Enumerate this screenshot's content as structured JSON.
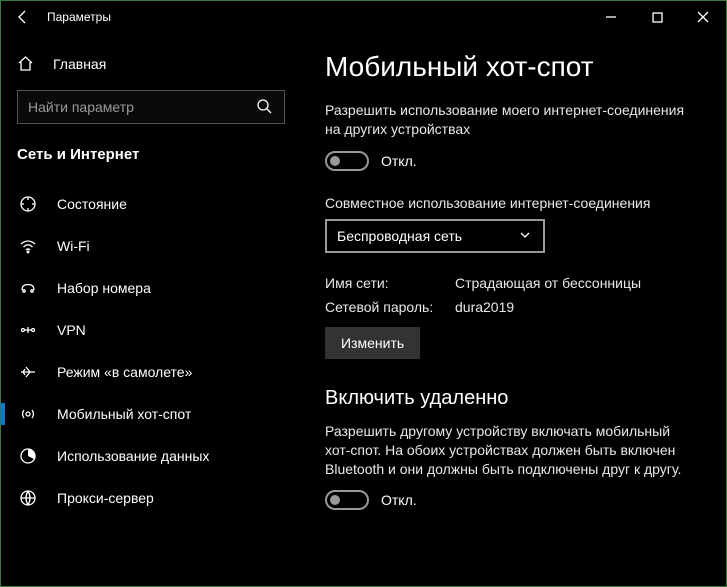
{
  "window": {
    "title": "Параметры"
  },
  "sidebar": {
    "home_label": "Главная",
    "search_placeholder": "Найти параметр",
    "category": "Сеть и Интернет",
    "items": [
      {
        "label": "Состояние"
      },
      {
        "label": "Wi-Fi"
      },
      {
        "label": "Набор номера"
      },
      {
        "label": "VPN"
      },
      {
        "label": "Режим «в самолете»"
      },
      {
        "label": "Мобильный хот-спот"
      },
      {
        "label": "Использование данных"
      },
      {
        "label": "Прокси-сервер"
      }
    ],
    "active_index": 5
  },
  "main": {
    "heading": "Мобильный хот-спот",
    "share_desc": "Разрешить использование моего интернет-соединения на других устройствах",
    "share_toggle_state": "Откл.",
    "share_from_label": "Совместное использование интернет-соединения",
    "share_from_value": "Беспроводная сеть",
    "net_name_label": "Имя сети:",
    "net_name_value": "Страдающая от бессонницы",
    "net_pass_label": "Сетевой пароль:",
    "net_pass_value": "dura2019",
    "edit_btn": "Изменить",
    "remote_heading": "Включить удаленно",
    "remote_desc": "Разрешить другому устройству включать мобильный хот-спот. На обоих устройствах должен быть включен Bluetooth и они должны быть подключены друг к другу.",
    "remote_toggle_state": "Откл."
  }
}
